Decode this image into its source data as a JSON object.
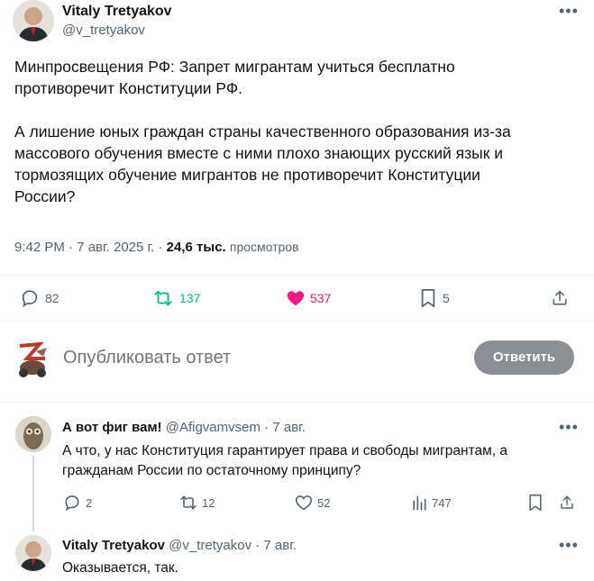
{
  "main_tweet": {
    "author_name": "Vitaly Tretyakov",
    "author_handle": "@v_tretyakov",
    "text_p1_line1": "Минпросвещения РФ: Запрет мигрантам учиться бесплатно",
    "text_p1_line2": "противоречит Конституции РФ.",
    "text_p2_line1": "А лишение юных граждан страны качественного образования из-за",
    "text_p2_line2": "массового обучения вместе с ними плохо знающих русский язык и",
    "text_p2_line3": "тормозящих обучение мигрантов не противоречит Конституции",
    "text_p2_line4": "России?",
    "timestamp": "9:42 PM · 7 авг. 2025 г. · ",
    "views_count": "24,6 тыс.",
    "views_label": "просмотров",
    "replies": "82",
    "retweets": "137",
    "likes": "537",
    "bookmarks": "5"
  },
  "compose": {
    "placeholder": "Опубликовать ответ",
    "reply_button": "Ответить"
  },
  "reply1": {
    "author_name": "А вот фиг вам!",
    "author_handle": "@Afigvamvsem",
    "time": "· 7 авг.",
    "text_line1": "А что, у нас Конституция гарантирует права и свободы мигрантам, а",
    "text_line2": "гражданам России по остаточному принципу?",
    "replies": "2",
    "retweets": "12",
    "likes": "52",
    "views": "747"
  },
  "reply2": {
    "author_name": "Vitaly Tretyakov",
    "author_handle": "@v_tretyakov",
    "time": "· 7 авг.",
    "text": "Оказывается, так."
  },
  "colors": {
    "retweet_green": "#00ba7c",
    "like_pink": "#f91880",
    "muted": "#536471"
  }
}
